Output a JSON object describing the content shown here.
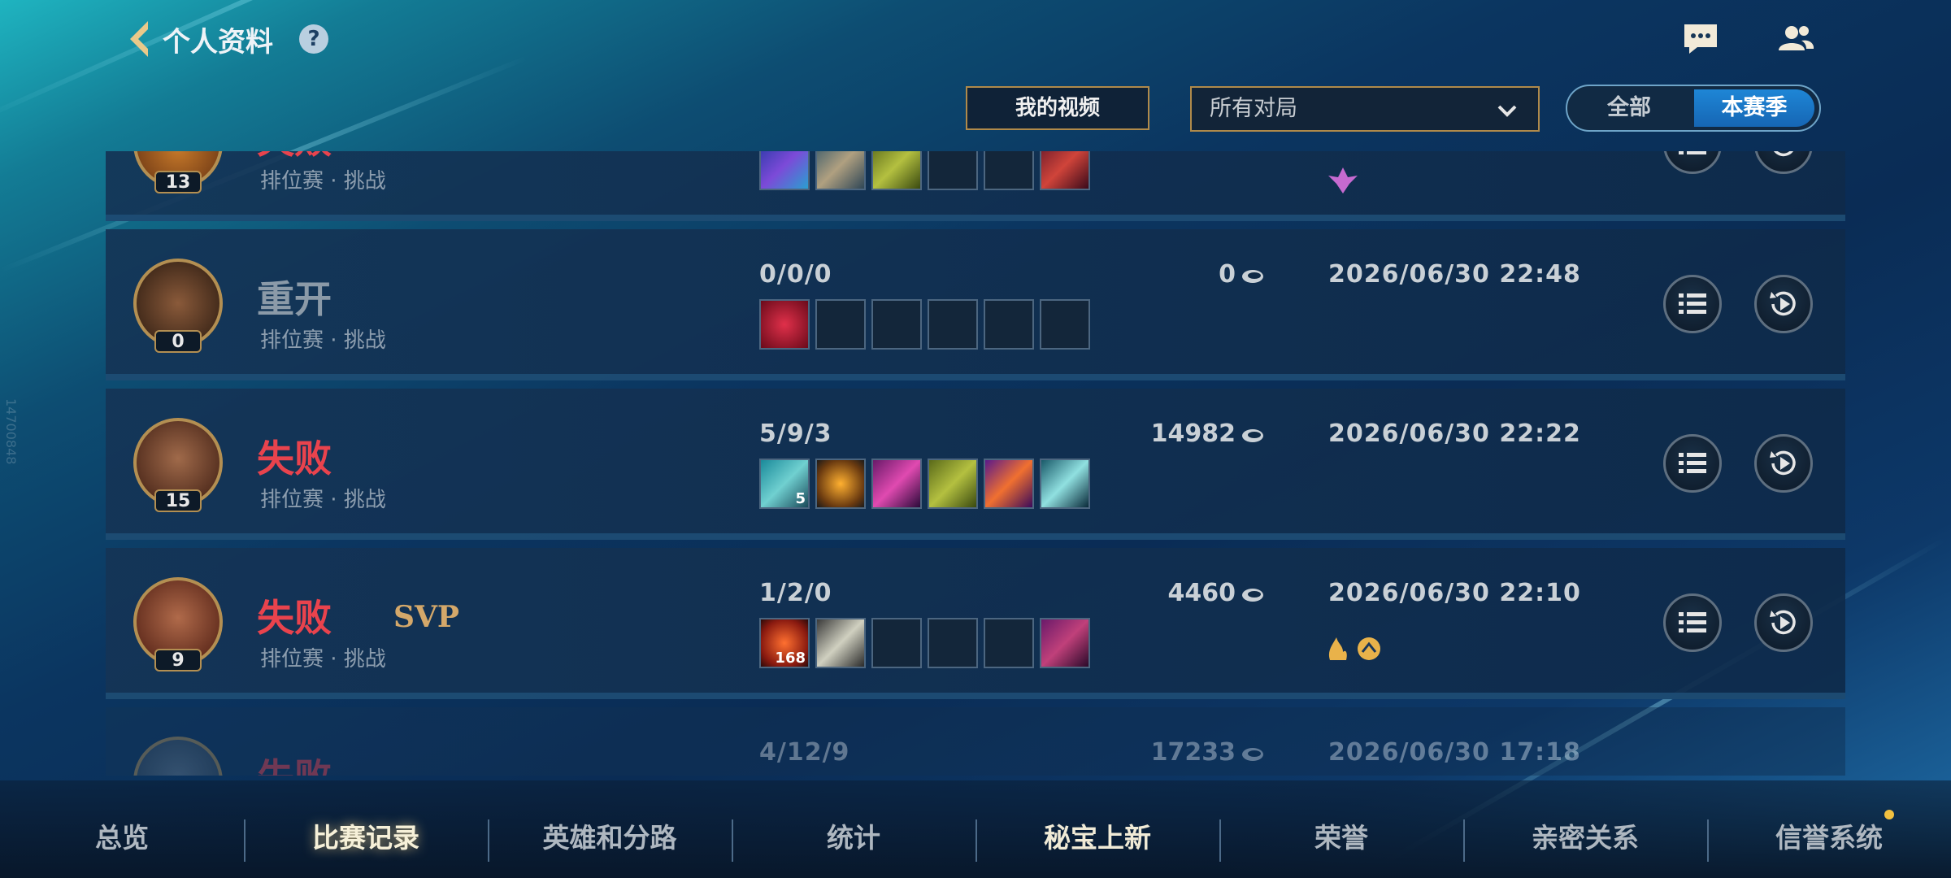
{
  "header": {
    "title": "个人资料",
    "help": "?"
  },
  "filters": {
    "video_btn": "我的视频",
    "match_type": "所有对局",
    "season_all": "全部",
    "season_current": "本赛季"
  },
  "side_id": "14700848",
  "matches": [
    {
      "result": "失败",
      "mode": "排位赛 · 挑战",
      "level": "13",
      "kda": "",
      "gold": "",
      "date": "",
      "svp": ""
    },
    {
      "result": "重开",
      "mode": "排位赛 · 挑战",
      "level": "0",
      "kda": "0/0/0",
      "gold": "0",
      "date": "2026/06/30 22:48",
      "svp": ""
    },
    {
      "result": "失败",
      "mode": "排位赛 · 挑战",
      "level": "15",
      "kda": "5/9/3",
      "gold": "14982",
      "date": "2026/06/30 22:22",
      "svp": "",
      "item_count": "5"
    },
    {
      "result": "失败",
      "mode": "排位赛 · 挑战",
      "level": "9",
      "kda": "1/2/0",
      "gold": "4460",
      "date": "2026/06/30 22:10",
      "svp": "SVP",
      "item_count": "168"
    },
    {
      "result": "失败",
      "mode": "",
      "level": "",
      "kda": "4/12/9",
      "gold": "17233",
      "date": "2026/06/30 17:18",
      "svp": ""
    }
  ],
  "nav": [
    "总览",
    "比赛记录",
    "英雄和分路",
    "统计",
    "秘宝上新",
    "荣誉",
    "亲密关系",
    "信誉系统"
  ],
  "nav_active": "比赛记录",
  "colors": {
    "loss": "#e9434d",
    "remake": "#8b9aa8",
    "gold_border": "#b08a4a",
    "accent": "#1e86d6"
  },
  "icons": [
    "back-arrow-icon",
    "help-icon",
    "chat-icon",
    "friends-icon",
    "chevron-down-icon",
    "list-icon",
    "replay-icon",
    "coin-icon"
  ]
}
